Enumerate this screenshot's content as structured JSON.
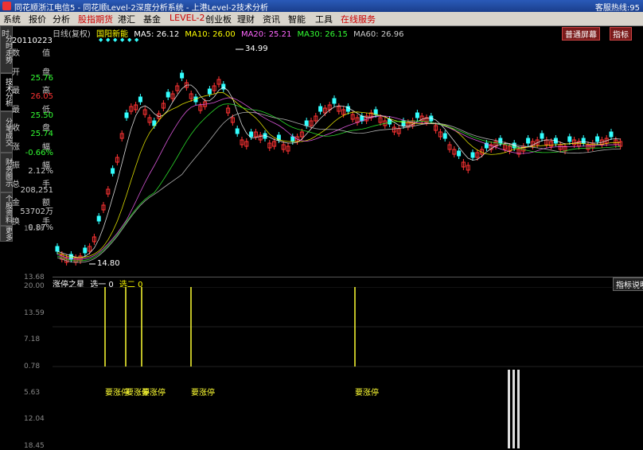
{
  "titlebar": {
    "title": "同花顺浙江电信5 - 同花顺Level-2深度分析系统 - 上港Level-2技术分析",
    "right": "客服热线:95"
  },
  "menu": [
    "系统",
    "报价",
    "分析",
    "股指期货",
    "港汇",
    "基金",
    "LEVEL-2",
    "创业板",
    "理财",
    "资讯",
    "智能",
    "工具",
    "在线服务"
  ],
  "sidetabs": [
    "分时走势",
    "技术分析",
    "分笔成交",
    "财务图示",
    "个股资料",
    "更多"
  ],
  "info": {
    "top_label": "时",
    "date": "20110223",
    "rows": [
      {
        "label": "数",
        "label2": "值",
        "value": ""
      },
      {
        "label": "开",
        "label2": "盘",
        "value": "25.76",
        "color": "#3f3"
      },
      {
        "label": "最",
        "label2": "高",
        "value": "26.05",
        "color": "#f33"
      },
      {
        "label": "最",
        "label2": "低",
        "value": "25.50",
        "color": "#3f3"
      },
      {
        "label": "收",
        "label2": "盘",
        "value": "25.74",
        "color": "#3f3"
      },
      {
        "label": "涨",
        "label2": "幅",
        "value": "-0.66%",
        "color": "#3f3"
      },
      {
        "label": "振",
        "label2": "幅",
        "value": "2.12%",
        "color": "#ccc"
      },
      {
        "label": "总",
        "label2": "手",
        "value": "208,251",
        "color": "#ccc"
      },
      {
        "label": "金",
        "label2": "额",
        "value": "53702万",
        "color": "#ccc"
      },
      {
        "label": "换",
        "label2": "手",
        "value": "0.87%",
        "color": "#ccc"
      }
    ],
    "axis_main": [
      "18.18",
      "13.68"
    ],
    "axis_sub": [
      "20.00",
      "13.59",
      "7.18",
      "0.78",
      "5.63",
      "12.04",
      "18.45"
    ]
  },
  "header": {
    "period": "日线(复权)",
    "name": "国阳新能",
    "ma5": "MA5: 26.12",
    "ma10": "MA10: 26.00",
    "ma20": "MA20: 25.21",
    "ma30": "MA30: 26.15",
    "ma60": "MA60: 26.96",
    "screen_btn": "普通屏幕",
    "right_btn": "指标"
  },
  "chart_data": {
    "type": "candlestick",
    "annotations": [
      "34.99",
      "14.80"
    ],
    "sub_title": "涨停之星",
    "sub_series": [
      "选一 0",
      "选二 0"
    ],
    "sub_labels": [
      "要涨停",
      "要涨停",
      "要涨停",
      "要涨停",
      "要涨停"
    ],
    "sub_right": "指标说明"
  },
  "colors": {
    "up": "#ff3333",
    "down": "#33ffff",
    "ma5": "#ffffff",
    "ma10": "#ffff00",
    "ma20": "#ff66ff",
    "ma30": "#33ff33",
    "ma60": "#cccccc"
  }
}
